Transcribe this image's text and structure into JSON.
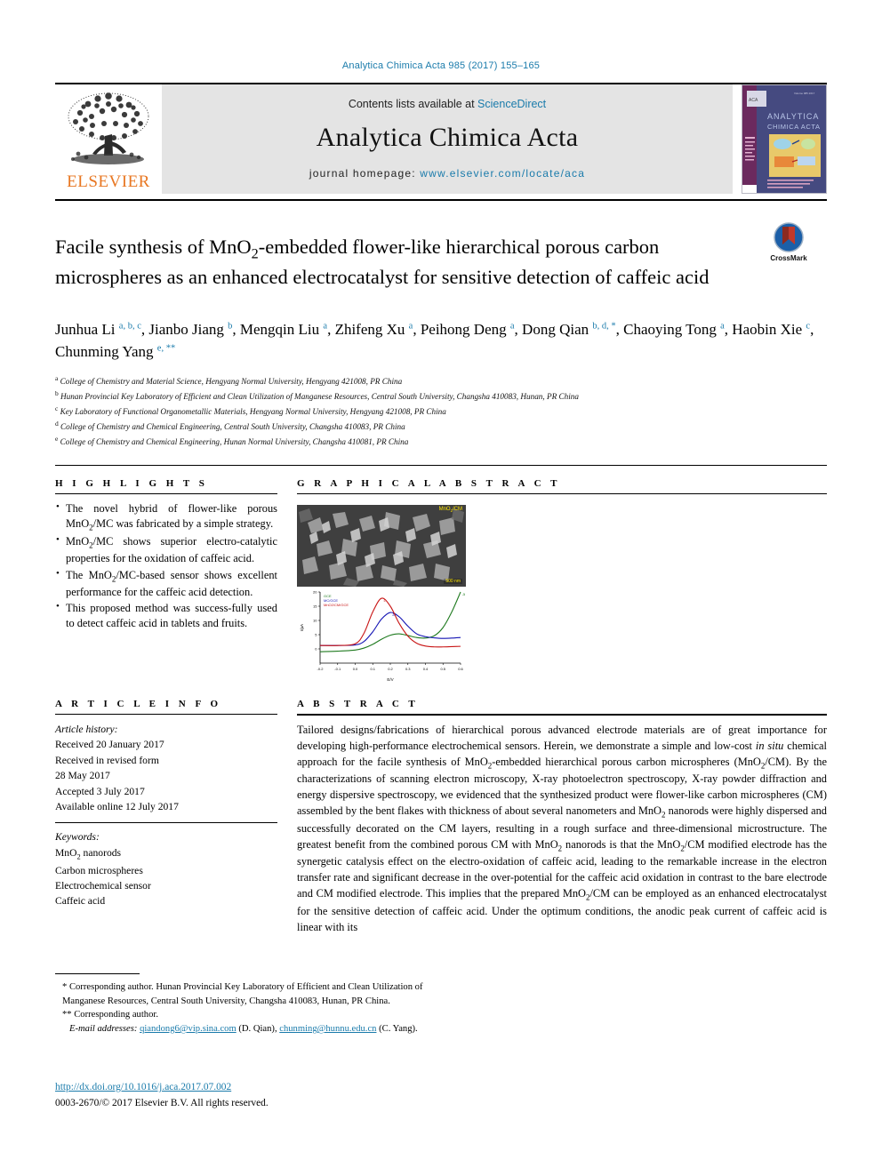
{
  "running_head": "Analytica Chimica Acta 985 (2017) 155–165",
  "masthead": {
    "publisher": "ELSEVIER",
    "contents_prefix": "Contents lists available at ",
    "contents_link": "ScienceDirect",
    "journal_name": "Analytica Chimica Acta",
    "homepage_prefix": "journal homepage: ",
    "homepage_url": "www.elsevier.com/locate/aca",
    "cover_title_line1": "ANALYTICA",
    "cover_title_line2": "CHIMICA ACTA",
    "link_color": "#1a7bab",
    "brand_color": "#E87722",
    "band_color": "#e4e4e4"
  },
  "article": {
    "title": "Facile synthesis of MnO2-embedded flower-like hierarchical porous carbon microspheres as an enhanced electrocatalyst for sensitive detection of caffeic acid",
    "crossmark_label": "CrossMark",
    "authors": [
      {
        "name": "Junhua Li",
        "marks": "a, b, c"
      },
      {
        "name": "Jianbo Jiang",
        "marks": "b"
      },
      {
        "name": "Mengqin Liu",
        "marks": "a"
      },
      {
        "name": "Zhifeng Xu",
        "marks": "a"
      },
      {
        "name": "Peihong Deng",
        "marks": "a"
      },
      {
        "name": "Dong Qian",
        "marks": "b, d, *"
      },
      {
        "name": "Chaoying Tong",
        "marks": "a"
      },
      {
        "name": "Haobin Xie",
        "marks": "c"
      },
      {
        "name": "Chunming Yang",
        "marks": "e, **"
      }
    ],
    "affiliations": [
      {
        "mark": "a",
        "text": "College of Chemistry and Material Science, Hengyang Normal University, Hengyang 421008, PR China"
      },
      {
        "mark": "b",
        "text": "Hunan Provincial Key Laboratory of Efficient and Clean Utilization of Manganese Resources, Central South University, Changsha 410083, Hunan, PR China"
      },
      {
        "mark": "c",
        "text": "Key Laboratory of Functional Organometallic Materials, Hengyang Normal University, Hengyang 421008, PR China"
      },
      {
        "mark": "d",
        "text": "College of Chemistry and Chemical Engineering, Central South University, Changsha 410083, PR China"
      },
      {
        "mark": "e",
        "text": "College of Chemistry and Chemical Engineering, Hunan Normal University, Changsha 410081, PR China"
      }
    ]
  },
  "highlights": {
    "heading": "H I G H L I G H T S",
    "items": [
      "The novel hybrid of flower-like porous MnO2/MC was fabricated by a simple strategy.",
      "MnO2/MC shows superior electro-catalytic properties for the oxidation of caffeic acid.",
      "The MnO2/MC-based sensor shows excellent performance for the caffeic acid detection.",
      "This proposed method was success-fully used to detect caffeic acid in tablets and fruits."
    ]
  },
  "graphical_abstract": {
    "heading": "G R A P H I C A L   A B S T R A C T",
    "sem_label": "MnO2/CM",
    "sem_scale": "500 nm"
  },
  "chart_data": {
    "type": "line",
    "title": "",
    "xlabel": "E/V",
    "ylabel": "I/µA",
    "xlim": [
      -0.2,
      0.6
    ],
    "ylim": [
      -5,
      20
    ],
    "xticks": [
      "-0.2",
      "-0.1",
      "0.0",
      "0.1",
      "0.2",
      "0.3",
      "0.4",
      "0.5",
      "0.6"
    ],
    "yticks": [
      "0",
      "5",
      "10",
      "15",
      "20"
    ],
    "grid": false,
    "legend_position": "top-left",
    "series": [
      {
        "name": "GCE",
        "color": "#1f7a1f",
        "curve_label": "a",
        "x": [
          -0.2,
          -0.1,
          0.0,
          0.05,
          0.1,
          0.15,
          0.2,
          0.25,
          0.3,
          0.35,
          0.4,
          0.45,
          0.5,
          0.55,
          0.6
        ],
        "y": [
          -1.0,
          -0.8,
          -0.4,
          0.3,
          1.6,
          3.4,
          4.8,
          5.3,
          4.7,
          4.0,
          3.8,
          4.6,
          7.5,
          13.0,
          20.0
        ]
      },
      {
        "name": "MC/GCE",
        "color": "#1414b4",
        "curve_label": "b",
        "x": [
          -0.2,
          -0.1,
          0.0,
          0.05,
          0.1,
          0.15,
          0.2,
          0.25,
          0.3,
          0.35,
          0.4,
          0.45,
          0.5,
          0.55,
          0.6
        ],
        "y": [
          1.2,
          1.2,
          1.4,
          2.6,
          6.0,
          10.5,
          12.8,
          11.3,
          8.0,
          5.3,
          4.3,
          3.9,
          3.7,
          3.8,
          4.0
        ]
      },
      {
        "name": "MnO2/CM/GCE",
        "color": "#c81414",
        "curve_label": "c",
        "x": [
          -0.2,
          -0.1,
          0.0,
          0.05,
          0.1,
          0.15,
          0.2,
          0.25,
          0.3,
          0.35,
          0.4,
          0.45,
          0.5,
          0.55,
          0.6
        ],
        "y": [
          1.2,
          1.2,
          1.8,
          5.5,
          13.0,
          17.8,
          15.0,
          9.0,
          4.5,
          2.0,
          1.0,
          0.7,
          0.7,
          0.8,
          0.9
        ]
      }
    ]
  },
  "article_info": {
    "heading": "A R T I C L E   I N F O",
    "history_label": "Article history:",
    "history": [
      "Received 20 January 2017",
      "Received in revised form",
      "28 May 2017",
      "Accepted 3 July 2017",
      "Available online 12 July 2017"
    ],
    "keywords_label": "Keywords:",
    "keywords": [
      "MnO2 nanorods",
      "Carbon microspheres",
      "Electrochemical sensor",
      "Caffeic acid"
    ]
  },
  "abstract": {
    "heading": "A B S T R A C T",
    "text": "Tailored designs/fabrications of hierarchical porous advanced electrode materials are of great importance for developing high-performance electrochemical sensors. Herein, we demonstrate a simple and low-cost in situ chemical approach for the facile synthesis of MnO2-embedded hierarchical porous carbon microspheres (MnO2/CM). By the characterizations of scanning electron microscopy, X-ray photoelectron spectroscopy, X-ray powder diffraction and energy dispersive spectroscopy, we evidenced that the synthesized product were flower-like carbon microspheres (CM) assembled by the bent flakes with thickness of about several nanometers and MnO2 nanorods were highly dispersed and successfully decorated on the CM layers, resulting in a rough surface and three-dimensional microstructure. The greatest benefit from the combined porous CM with MnO2 nanorods is that the MnO2/CM modified electrode has the synergetic catalysis effect on the electro-oxidation of caffeic acid, leading to the remarkable increase in the electron transfer rate and significant decrease in the over-potential for the caffeic acid oxidation in contrast to the bare electrode and CM modified electrode. This implies that the prepared MnO2/CM can be employed as an enhanced electrocatalyst for the sensitive detection of caffeic acid. Under the optimum conditions, the anodic peak current of caffeic acid is linear with its"
  },
  "footnotes": {
    "corresponding_1": "* Corresponding author. Hunan Provincial Key Laboratory of Efficient and Clean Utilization of Manganese Resources, Central South University, Changsha 410083, Hunan, PR China.",
    "corresponding_2": "** Corresponding author.",
    "email_label": "E-mail addresses:",
    "email_1": "qiandong6@vip.sina.com",
    "email_1_owner": "(D. Qian),",
    "email_2": "chunming@hunnu.edu.cn",
    "email_2_owner": "(C. Yang)."
  },
  "doi": {
    "url": "http://dx.doi.org/10.1016/j.aca.2017.07.002",
    "copyright": "0003-2670/© 2017 Elsevier B.V. All rights reserved."
  }
}
